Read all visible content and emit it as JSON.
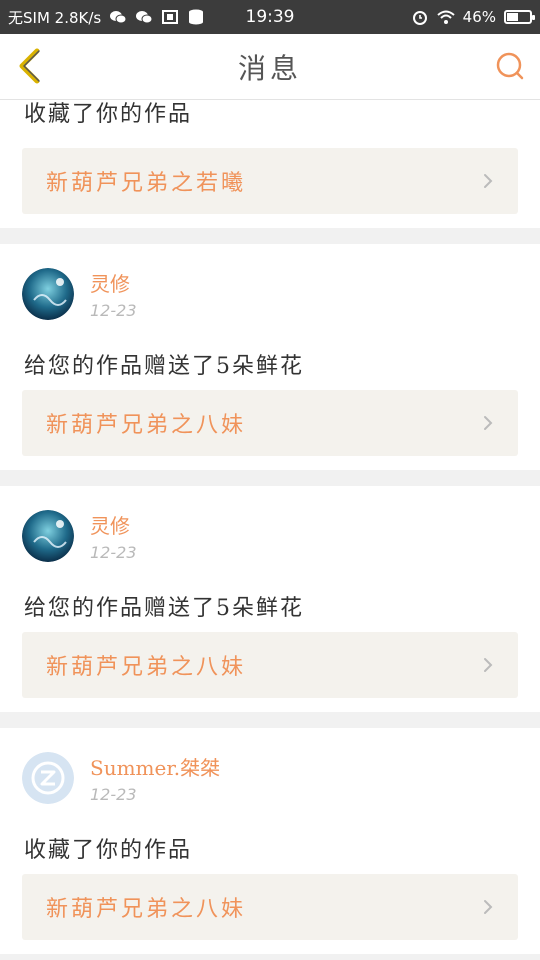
{
  "status_bar": {
    "left_text": "无SIM 2.8K/s",
    "time": "19:39",
    "battery": "46%"
  },
  "header": {
    "title": "消息",
    "back_icon": "chevron-left-icon",
    "search_icon": "search-icon"
  },
  "colors": {
    "accent": "#f0935a",
    "back_icon": "#d9b200",
    "link_bg": "#f4f2ed",
    "separator": "#f1f1f1"
  },
  "cards": [
    {
      "action": "收藏了你的作品",
      "work": "新葫芦兄弟之若曦"
    },
    {
      "user": "灵修",
      "date": "12-23",
      "action": "给您的作品赠送了5朵鲜花",
      "work": "新葫芦兄弟之八妹",
      "avatar": "avatar-lingxiu"
    },
    {
      "user": "灵修",
      "date": "12-23",
      "action": "给您的作品赠送了5朵鲜花",
      "work": "新葫芦兄弟之八妹",
      "avatar": "avatar-lingxiu"
    },
    {
      "user": "Summer.桀桀",
      "date": "12-23",
      "action": "收藏了你的作品",
      "work": "新葫芦兄弟之八妹",
      "avatar": "avatar-default-qq"
    }
  ]
}
